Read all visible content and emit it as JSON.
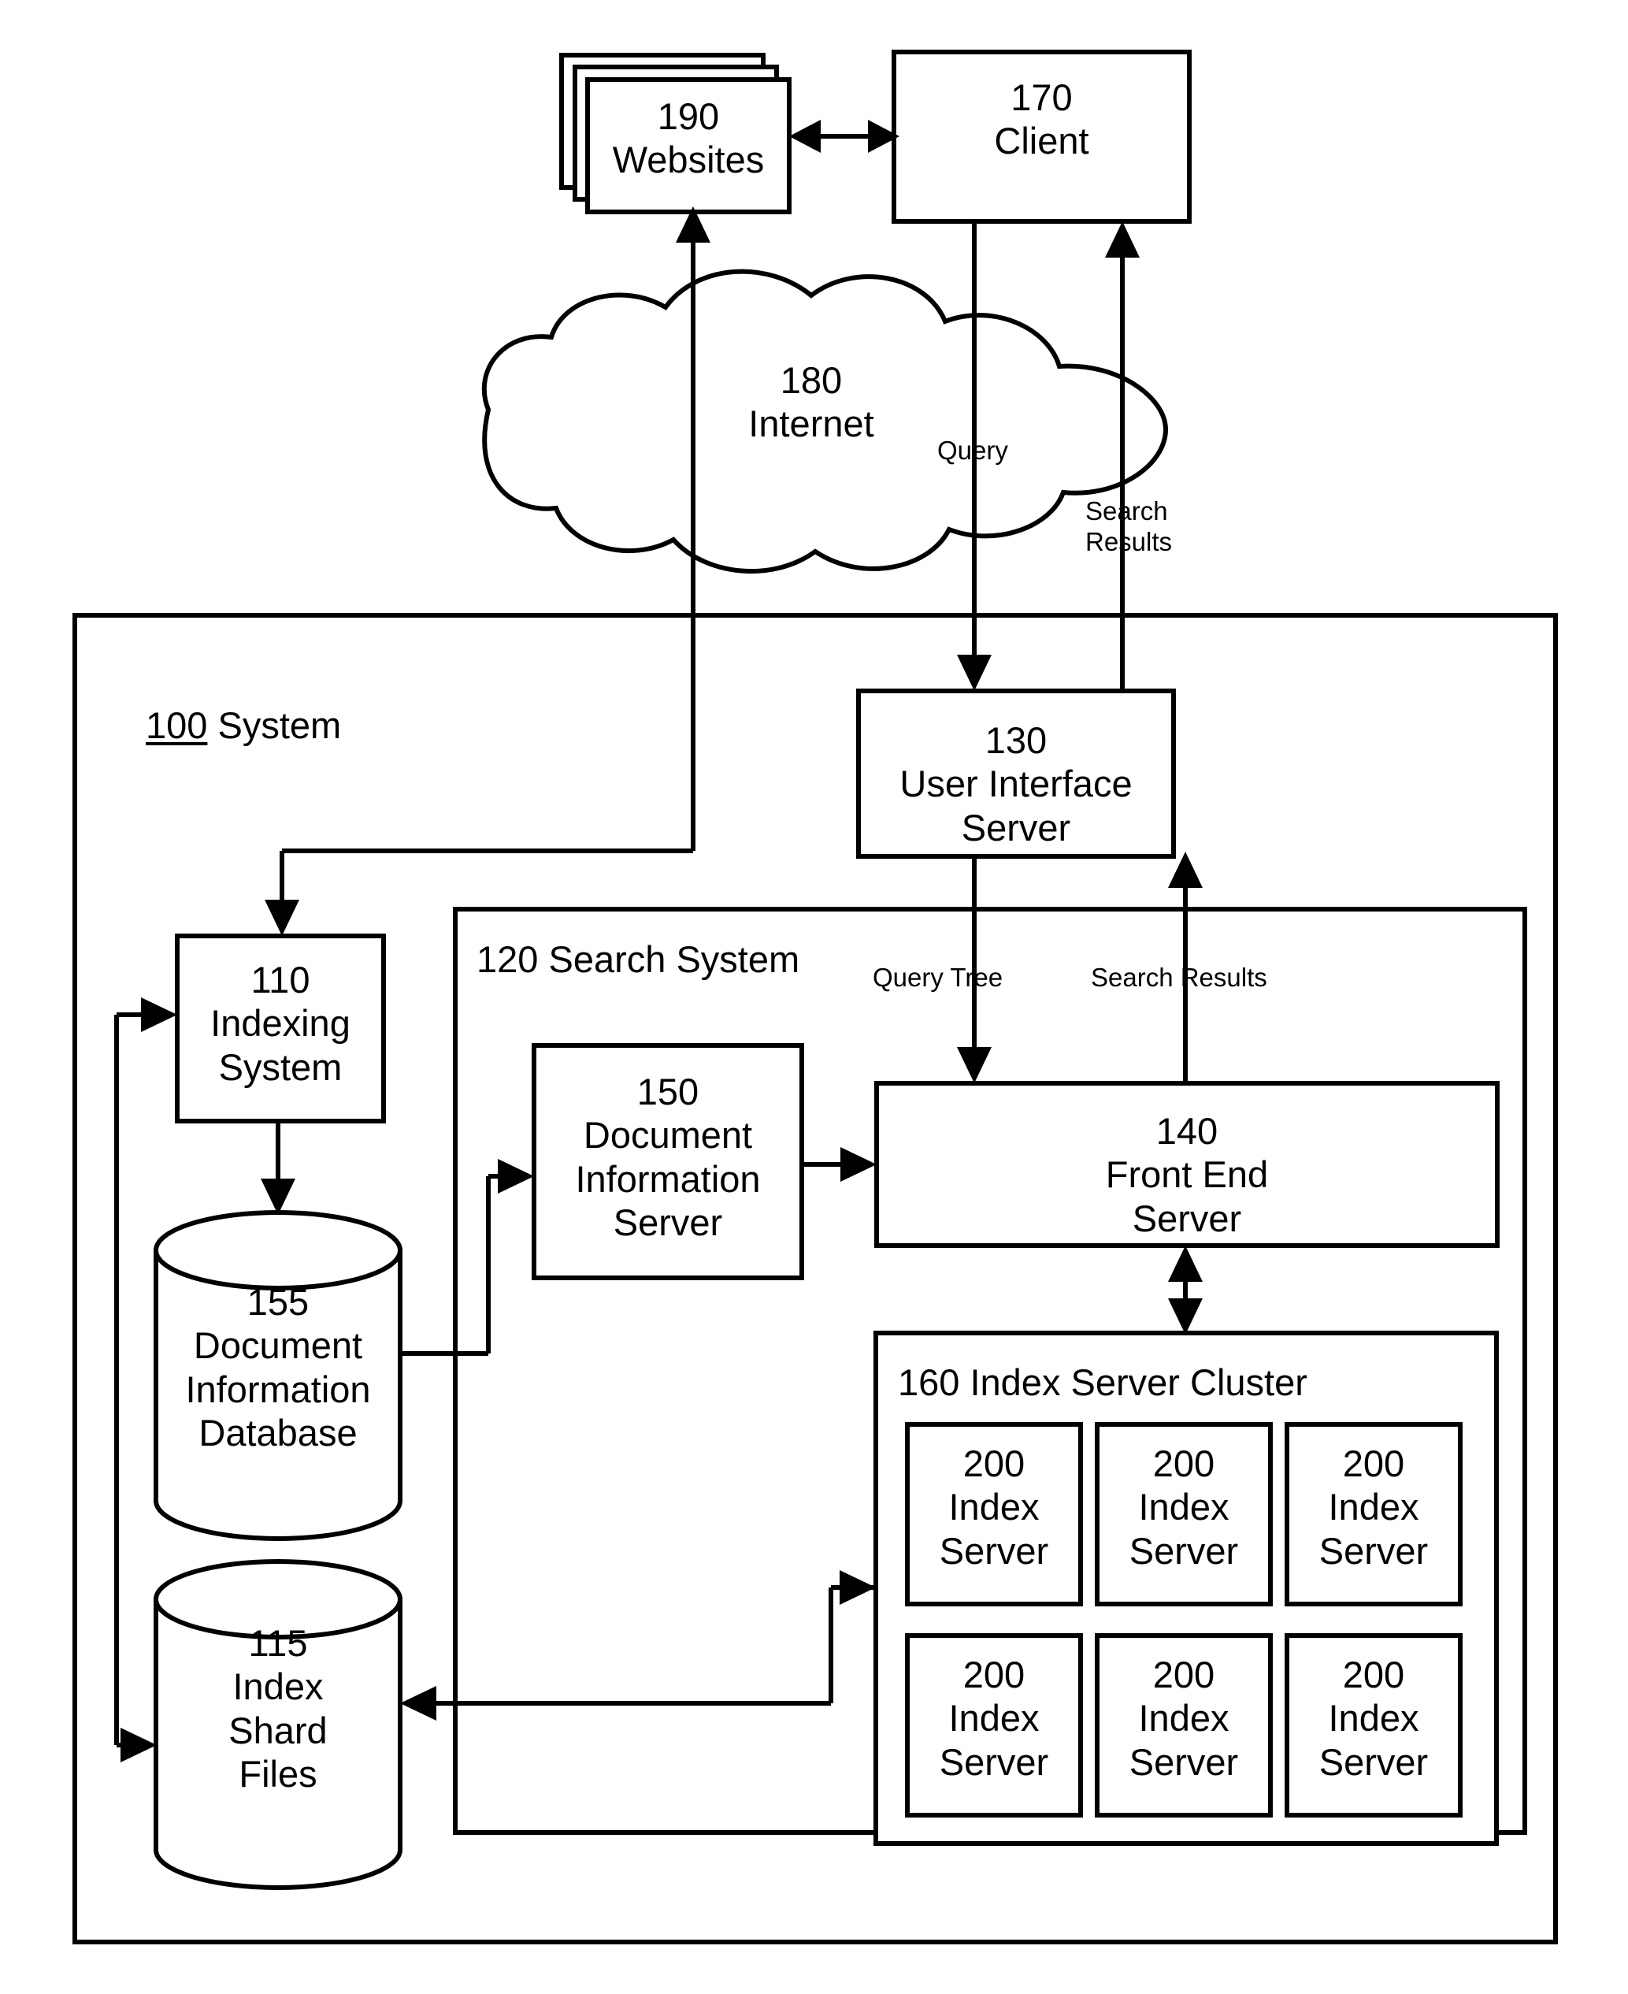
{
  "diagram": {
    "title_block": "100 System",
    "nodes": {
      "websites": {
        "ref": "190",
        "name": "Websites",
        "text": "190\nWebsites"
      },
      "client": {
        "ref": "170",
        "name": "Client",
        "text": "170\nClient"
      },
      "internet": {
        "ref": "180",
        "name": "Internet",
        "text": "180\nInternet"
      },
      "system": {
        "ref": "100",
        "name": "System",
        "text": "100 System"
      },
      "ui_server": {
        "ref": "130",
        "name": "User Interface Server",
        "text": "130\nUser Interface\nServer"
      },
      "search_system": {
        "ref": "120",
        "name": "Search System",
        "text": "120 Search System"
      },
      "indexing_system": {
        "ref": "110",
        "name": "Indexing System",
        "text": "110\nIndexing\nSystem"
      },
      "doc_info_db": {
        "ref": "155",
        "name": "Document Information Database",
        "text": "155\nDocument\nInformation\nDatabase"
      },
      "index_shard_files": {
        "ref": "115",
        "name": "Index Shard Files",
        "text": "115\nIndex\nShard\nFiles"
      },
      "doc_info_server": {
        "ref": "150",
        "name": "Document Information Server",
        "text": "150\nDocument\nInformation\nServer"
      },
      "front_end_server": {
        "ref": "140",
        "name": "Front End Server",
        "text": "140\nFront End\nServer"
      },
      "index_server_cluster": {
        "ref": "160",
        "name": "Index Server Cluster",
        "text": "160 Index Server Cluster"
      }
    },
    "index_servers": [
      {
        "ref": "200",
        "name": "Index Server",
        "text": "200\nIndex\nServer"
      },
      {
        "ref": "200",
        "name": "Index Server",
        "text": "200\nIndex\nServer"
      },
      {
        "ref": "200",
        "name": "Index Server",
        "text": "200\nIndex\nServer"
      },
      {
        "ref": "200",
        "name": "Index Server",
        "text": "200\nIndex\nServer"
      },
      {
        "ref": "200",
        "name": "Index Server",
        "text": "200\nIndex\nServer"
      },
      {
        "ref": "200",
        "name": "Index Server",
        "text": "200\nIndex\nServer"
      }
    ],
    "edge_labels": {
      "query": "Query",
      "search_results": "Search\nResults",
      "query_tree": "Query Tree",
      "search_results_internal": "Search Results"
    },
    "colors": {
      "stroke": "#000000",
      "fill": "#ffffff"
    }
  }
}
